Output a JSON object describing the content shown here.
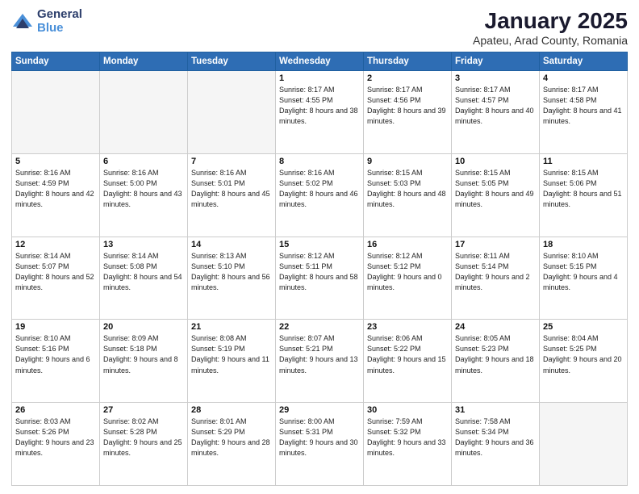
{
  "logo": {
    "general": "General",
    "blue": "Blue"
  },
  "header": {
    "title": "January 2025",
    "location": "Apateu, Arad County, Romania"
  },
  "weekdays": [
    "Sunday",
    "Monday",
    "Tuesday",
    "Wednesday",
    "Thursday",
    "Friday",
    "Saturday"
  ],
  "weeks": [
    [
      {
        "day": "",
        "info": ""
      },
      {
        "day": "",
        "info": ""
      },
      {
        "day": "",
        "info": ""
      },
      {
        "day": "1",
        "info": "Sunrise: 8:17 AM\nSunset: 4:55 PM\nDaylight: 8 hours\nand 38 minutes."
      },
      {
        "day": "2",
        "info": "Sunrise: 8:17 AM\nSunset: 4:56 PM\nDaylight: 8 hours\nand 39 minutes."
      },
      {
        "day": "3",
        "info": "Sunrise: 8:17 AM\nSunset: 4:57 PM\nDaylight: 8 hours\nand 40 minutes."
      },
      {
        "day": "4",
        "info": "Sunrise: 8:17 AM\nSunset: 4:58 PM\nDaylight: 8 hours\nand 41 minutes."
      }
    ],
    [
      {
        "day": "5",
        "info": "Sunrise: 8:16 AM\nSunset: 4:59 PM\nDaylight: 8 hours\nand 42 minutes."
      },
      {
        "day": "6",
        "info": "Sunrise: 8:16 AM\nSunset: 5:00 PM\nDaylight: 8 hours\nand 43 minutes."
      },
      {
        "day": "7",
        "info": "Sunrise: 8:16 AM\nSunset: 5:01 PM\nDaylight: 8 hours\nand 45 minutes."
      },
      {
        "day": "8",
        "info": "Sunrise: 8:16 AM\nSunset: 5:02 PM\nDaylight: 8 hours\nand 46 minutes."
      },
      {
        "day": "9",
        "info": "Sunrise: 8:15 AM\nSunset: 5:03 PM\nDaylight: 8 hours\nand 48 minutes."
      },
      {
        "day": "10",
        "info": "Sunrise: 8:15 AM\nSunset: 5:05 PM\nDaylight: 8 hours\nand 49 minutes."
      },
      {
        "day": "11",
        "info": "Sunrise: 8:15 AM\nSunset: 5:06 PM\nDaylight: 8 hours\nand 51 minutes."
      }
    ],
    [
      {
        "day": "12",
        "info": "Sunrise: 8:14 AM\nSunset: 5:07 PM\nDaylight: 8 hours\nand 52 minutes."
      },
      {
        "day": "13",
        "info": "Sunrise: 8:14 AM\nSunset: 5:08 PM\nDaylight: 8 hours\nand 54 minutes."
      },
      {
        "day": "14",
        "info": "Sunrise: 8:13 AM\nSunset: 5:10 PM\nDaylight: 8 hours\nand 56 minutes."
      },
      {
        "day": "15",
        "info": "Sunrise: 8:12 AM\nSunset: 5:11 PM\nDaylight: 8 hours\nand 58 minutes."
      },
      {
        "day": "16",
        "info": "Sunrise: 8:12 AM\nSunset: 5:12 PM\nDaylight: 9 hours\nand 0 minutes."
      },
      {
        "day": "17",
        "info": "Sunrise: 8:11 AM\nSunset: 5:14 PM\nDaylight: 9 hours\nand 2 minutes."
      },
      {
        "day": "18",
        "info": "Sunrise: 8:10 AM\nSunset: 5:15 PM\nDaylight: 9 hours\nand 4 minutes."
      }
    ],
    [
      {
        "day": "19",
        "info": "Sunrise: 8:10 AM\nSunset: 5:16 PM\nDaylight: 9 hours\nand 6 minutes."
      },
      {
        "day": "20",
        "info": "Sunrise: 8:09 AM\nSunset: 5:18 PM\nDaylight: 9 hours\nand 8 minutes."
      },
      {
        "day": "21",
        "info": "Sunrise: 8:08 AM\nSunset: 5:19 PM\nDaylight: 9 hours\nand 11 minutes."
      },
      {
        "day": "22",
        "info": "Sunrise: 8:07 AM\nSunset: 5:21 PM\nDaylight: 9 hours\nand 13 minutes."
      },
      {
        "day": "23",
        "info": "Sunrise: 8:06 AM\nSunset: 5:22 PM\nDaylight: 9 hours\nand 15 minutes."
      },
      {
        "day": "24",
        "info": "Sunrise: 8:05 AM\nSunset: 5:23 PM\nDaylight: 9 hours\nand 18 minutes."
      },
      {
        "day": "25",
        "info": "Sunrise: 8:04 AM\nSunset: 5:25 PM\nDaylight: 9 hours\nand 20 minutes."
      }
    ],
    [
      {
        "day": "26",
        "info": "Sunrise: 8:03 AM\nSunset: 5:26 PM\nDaylight: 9 hours\nand 23 minutes."
      },
      {
        "day": "27",
        "info": "Sunrise: 8:02 AM\nSunset: 5:28 PM\nDaylight: 9 hours\nand 25 minutes."
      },
      {
        "day": "28",
        "info": "Sunrise: 8:01 AM\nSunset: 5:29 PM\nDaylight: 9 hours\nand 28 minutes."
      },
      {
        "day": "29",
        "info": "Sunrise: 8:00 AM\nSunset: 5:31 PM\nDaylight: 9 hours\nand 30 minutes."
      },
      {
        "day": "30",
        "info": "Sunrise: 7:59 AM\nSunset: 5:32 PM\nDaylight: 9 hours\nand 33 minutes."
      },
      {
        "day": "31",
        "info": "Sunrise: 7:58 AM\nSunset: 5:34 PM\nDaylight: 9 hours\nand 36 minutes."
      },
      {
        "day": "",
        "info": ""
      }
    ]
  ]
}
